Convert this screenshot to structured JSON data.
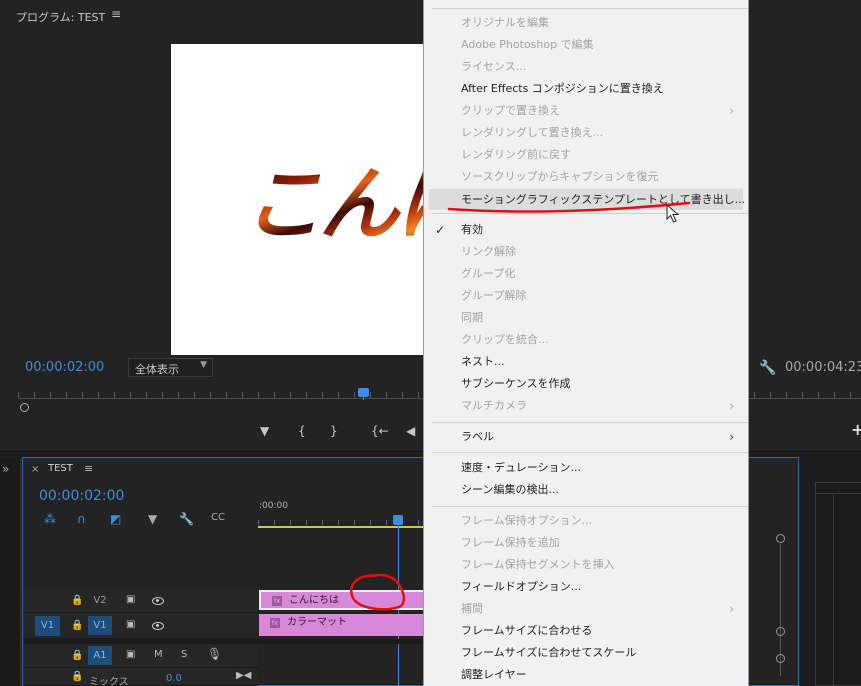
{
  "monitor": {
    "title": "プログラム: TEST",
    "menu_icon": "≡",
    "video_text": "こんに",
    "timecode": "00:00:02:00",
    "fit": "全体表示",
    "timecode_end": "00:00:04:23",
    "controls": {
      "marker": "▼",
      "in": "{",
      "out": "}",
      "go_in": "{←",
      "step_back": "◀",
      "add": "+"
    }
  },
  "timeline": {
    "expand": "»",
    "close": "×",
    "title": "TEST",
    "menu_icon": "≡",
    "timecode": "00:00:02:00",
    "ruler_label": ":00:00",
    "tracks": {
      "v2": "V2",
      "v1": "V1",
      "v1_source": "V1",
      "a1": "A1",
      "mute": "M",
      "solo": "S",
      "mix_label": "ミックス",
      "mix_value": "0.0"
    },
    "clips": {
      "v2": "こんにちは",
      "v1": "カラーマット",
      "fx": "fx"
    }
  },
  "context_menu": {
    "items": [
      {
        "label": "オリジナルを編集",
        "enabled": false
      },
      {
        "label": "Adobe Photoshop で編集",
        "enabled": false
      },
      {
        "label": "ライセンス...",
        "enabled": false
      },
      {
        "label": "After Effects コンポジションに置き換え",
        "enabled": true
      },
      {
        "label": "クリップで置き換え",
        "enabled": false,
        "submenu": true
      },
      {
        "label": "レンダリングして置き換え...",
        "enabled": false
      },
      {
        "label": "レンダリング前に戻す",
        "enabled": false
      },
      {
        "label": "ソースクリップからキャプションを復元",
        "enabled": false
      },
      {
        "label": "モーショングラフィックステンプレートとして書き出し...",
        "enabled": true,
        "highlighted": true
      },
      {
        "label": "有効",
        "enabled": true,
        "checked": true
      },
      {
        "label": "リンク解除",
        "enabled": false
      },
      {
        "label": "グループ化",
        "enabled": false
      },
      {
        "label": "グループ解除",
        "enabled": false
      },
      {
        "label": "同期",
        "enabled": false
      },
      {
        "label": "クリップを統合...",
        "enabled": false
      },
      {
        "label": "ネスト...",
        "enabled": true
      },
      {
        "label": "サブシーケンスを作成",
        "enabled": true
      },
      {
        "label": "マルチカメラ",
        "enabled": false,
        "submenu": true
      },
      {
        "label": "ラベル",
        "enabled": true,
        "submenu": true
      },
      {
        "label": "速度・デュレーション...",
        "enabled": true
      },
      {
        "label": "シーン編集の検出...",
        "enabled": true
      },
      {
        "label": "フレーム保持オプション...",
        "enabled": false
      },
      {
        "label": "フレーム保持を追加",
        "enabled": false
      },
      {
        "label": "フレーム保持セグメントを挿入",
        "enabled": false
      },
      {
        "label": "フィールドオプション...",
        "enabled": true
      },
      {
        "label": "補間",
        "enabled": false,
        "submenu": true
      },
      {
        "label": "フレームサイズに合わせる",
        "enabled": true
      },
      {
        "label": "フレームサイズに合わせてスケール",
        "enabled": true
      },
      {
        "label": "調整レイヤー",
        "enabled": true
      }
    ],
    "check_mark": "✓",
    "submenu_arrow": "›"
  },
  "colors": {
    "accent_blue": "#3d8ee0",
    "clip_pink": "#d888d8",
    "annotation_red": "#e01010",
    "menu_bg": "#f1f1f1"
  }
}
